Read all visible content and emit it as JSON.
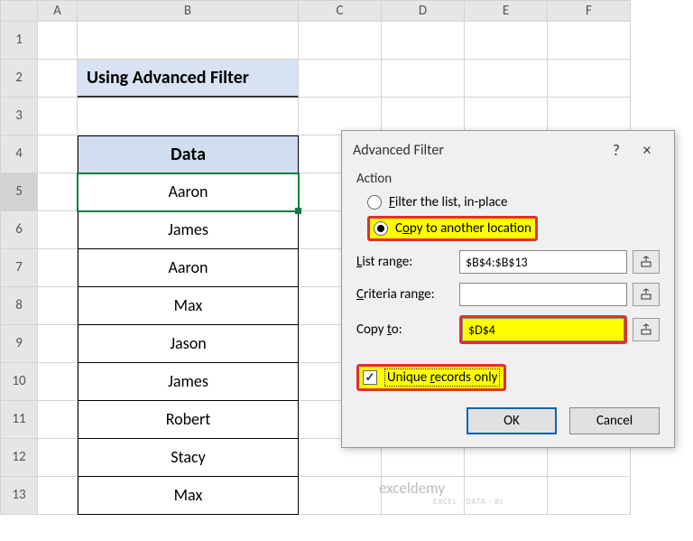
{
  "columns": [
    "A",
    "B",
    "C",
    "D",
    "E",
    "F"
  ],
  "rows": [
    "1",
    "2",
    "3",
    "4",
    "5",
    "6",
    "7",
    "8",
    "9",
    "10",
    "11",
    "12",
    "13"
  ],
  "title_cell": "Using Advanced Filter",
  "table": {
    "header": "Data",
    "values": [
      "Aaron",
      "James",
      "Aaron",
      "Max",
      "Jason",
      "James",
      "Robert",
      "Stacy",
      "Max"
    ]
  },
  "dialog": {
    "title": "Advanced Filter",
    "help": "?",
    "close": "×",
    "action_label": "Action",
    "radio_inplace": "Filter the list, in-place",
    "radio_copy": "Copy to another location",
    "list_range_label": "List range:",
    "list_range_value": "$B$4:$B$13",
    "criteria_range_label": "Criteria range:",
    "criteria_range_value": "",
    "copy_to_label": "Copy to:",
    "copy_to_value": "$D$4",
    "unique_label": "Unique records only",
    "ok": "OK",
    "cancel": "Cancel"
  },
  "watermark": "exceldemy",
  "watermark_sub": "EXCEL · DATA · BI"
}
